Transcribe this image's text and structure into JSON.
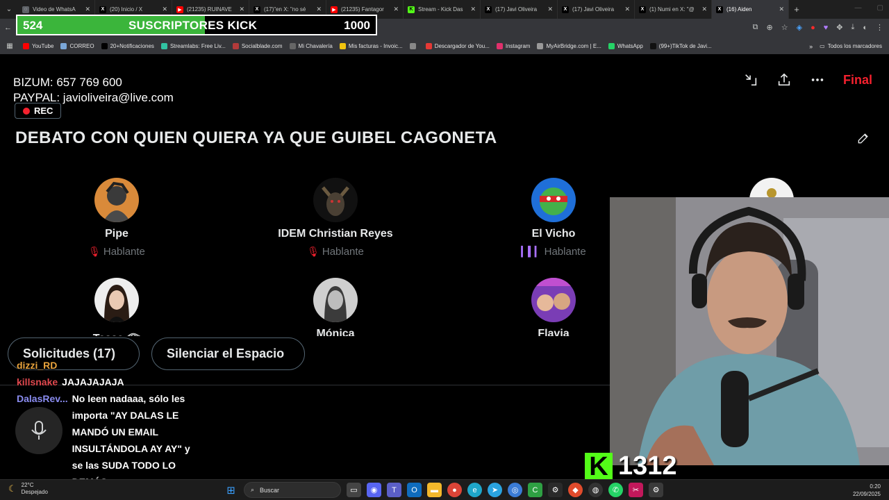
{
  "browser": {
    "tabs": [
      {
        "title": "Video de WhatsA",
        "icon": "globe-icon",
        "color": "#5f6368",
        "active": false
      },
      {
        "title": "(20) Inicio / X",
        "icon": "x-logo-icon",
        "color": "#000000",
        "active": false
      },
      {
        "title": "(21235) RUINAVE",
        "icon": "youtube-icon",
        "color": "#ff0000",
        "active": false
      },
      {
        "title": "(17)\"en X: \"no sé",
        "icon": "x-logo-icon",
        "color": "#000000",
        "active": false
      },
      {
        "title": "(21235) Fantagor",
        "icon": "youtube-icon",
        "color": "#ff0000",
        "active": false
      },
      {
        "title": "Stream - Kick Das",
        "icon": "kick-icon",
        "color": "#53fc18",
        "active": false
      },
      {
        "title": "(17) Javi Oliveira",
        "icon": "x-logo-icon",
        "color": "#000000",
        "active": false
      },
      {
        "title": "(17) Javi Oliveira",
        "icon": "x-logo-icon",
        "color": "#000000",
        "active": false
      },
      {
        "title": "(1) Numi en X: \"@",
        "icon": "x-logo-icon",
        "color": "#000000",
        "active": false
      },
      {
        "title": "(16) Aiden",
        "icon": "x-logo-icon",
        "color": "#000000",
        "active": true
      }
    ],
    "new_tab": "+",
    "bookmarks": [
      {
        "label": "YouTube",
        "color": "#ff0000"
      },
      {
        "label": "CORREO",
        "color": "#7aa7d8"
      },
      {
        "label": "20+Notificaciones",
        "color": "#000000"
      },
      {
        "label": "Streamlabs: Free Liv...",
        "color": "#31c3a2"
      },
      {
        "label": "Socialblade.com",
        "color": "#b33a3a"
      },
      {
        "label": "Mi Chavalería",
        "color": "#666666"
      },
      {
        "label": "Mis facturas - Invoic...",
        "color": "#f1c40f"
      },
      {
        "label": "",
        "color": "#888888"
      },
      {
        "label": "Descargador de You...",
        "color": "#e53935"
      },
      {
        "label": "Instagram",
        "color": "#e1306c"
      },
      {
        "label": "MyAirBridge.com | E...",
        "color": "#999999"
      },
      {
        "label": "WhatsApp",
        "color": "#25d366"
      },
      {
        "label": "(99+)TikTok de Javi...",
        "color": "#111111"
      }
    ],
    "bookmarks_more": "»",
    "bookmarks_folder": "Todos los marcadores"
  },
  "sub_goal": {
    "current": "524",
    "title": "SUSCRIPTORES KICK",
    "target": "1000",
    "progress": 0.524
  },
  "space": {
    "donate_line1": "BIZUM: 657 769 600",
    "donate_line2": "PAYPAL: javioliveira@live.com",
    "rec_label": "REC",
    "end_label": "Final",
    "title": "DEBATO CON QUIEN QUIERA YA QUE GUIBEL CAGONETA",
    "speakers": [
      {
        "name": "Pipe",
        "role": "Hablante",
        "mic": "muted"
      },
      {
        "name": "IDEM Christian Reyes",
        "role": "Hablante",
        "mic": "muted"
      },
      {
        "name": "El Vicho",
        "role": "Hablante",
        "mic": "speaking"
      }
    ],
    "listeners": [
      {
        "name": "Tessa 𓂀"
      },
      {
        "name": "Mónica"
      },
      {
        "name": "Flavia"
      }
    ],
    "requests_button": "Solicitudes (17)",
    "mute_button": "Silenciar el Espacio"
  },
  "chat": [
    {
      "user": "dizzi_RD",
      "color": "#e8a33d",
      "text": ""
    },
    {
      "user": "killsnake",
      "color": "#e0484e",
      "text": "JAJAJAJAJA"
    },
    {
      "user": "DalasRev...",
      "color": "#8a8cf0",
      "text": "No leen nadaaa, sólo les importa \"AY DALAS LE MANDÓ UN EMAIL INSULTÁNDOLA AY AY\" y se las SUDA TODO LO DEMÁS"
    }
  ],
  "kick_viewers": "1312",
  "taskbar": {
    "temp": "22°C",
    "weather": "Despejado",
    "search_placeholder": "Buscar",
    "time": "0:20",
    "date": "22/09/2025"
  }
}
